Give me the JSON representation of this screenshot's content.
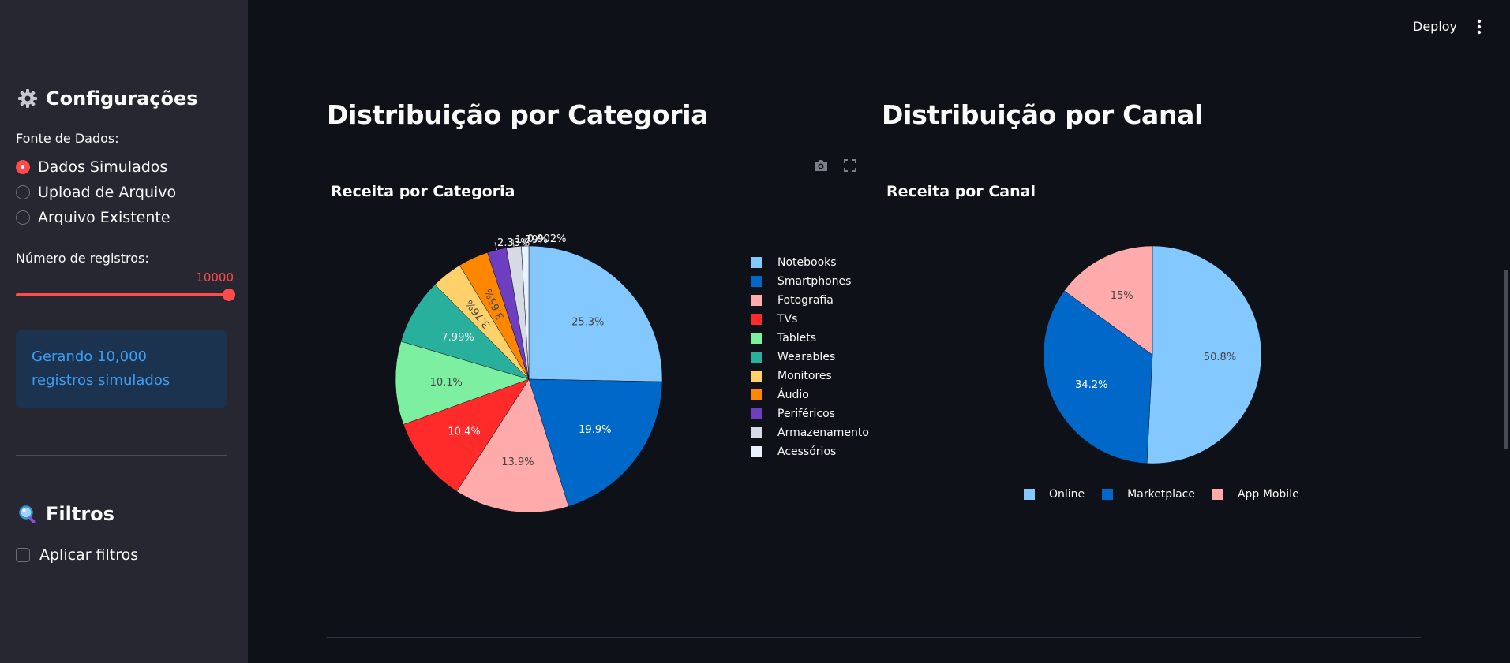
{
  "sidebar": {
    "config_heading": "Configurações",
    "data_source_label": "Fonte de Dados:",
    "radio_options": [
      {
        "label": "Dados Simulados",
        "selected": true
      },
      {
        "label": "Upload de Arquivo",
        "selected": false
      },
      {
        "label": "Arquivo Existente",
        "selected": false
      }
    ],
    "records_label": "Número de registros:",
    "records_value": "10000",
    "records_fraction": 1.0,
    "info_message": "Gerando 10,000 registros simulados",
    "filters_heading": "Filtros",
    "apply_filters_label": "Aplicar filtros",
    "apply_filters_checked": false
  },
  "header": {
    "deploy_label": "Deploy"
  },
  "main": {
    "left_heading": "Distribuição por Categoria",
    "right_heading": "Distribuição por Canal"
  },
  "chart_data": [
    {
      "type": "pie",
      "title": "Receita por Categoria",
      "labels": [
        "Notebooks",
        "Smartphones",
        "Fotografia",
        "TVs",
        "Tablets",
        "Wearables",
        "Monitores",
        "Áudio",
        "Periféricos",
        "Armazenamento",
        "Acessórios"
      ],
      "values": [
        25.3,
        19.9,
        13.9,
        10.4,
        10.1,
        7.99,
        3.76,
        3.65,
        2.33,
        1.79,
        0.902
      ],
      "text_labels": [
        "25.3%",
        "19.9%",
        "13.9%",
        "10.4%",
        "10.1%",
        "7.99%",
        "3.76%",
        "3.65%",
        "2.33%",
        "1.79%",
        "0.902%"
      ],
      "colors": [
        "#83c9ff",
        "#0068c9",
        "#ffabab",
        "#ff2b2b",
        "#7defa1",
        "#29b09d",
        "#ffd16a",
        "#ff8700",
        "#6d3fc0",
        "#d5dae5",
        "#e8f3ff"
      ],
      "legend_position": "right"
    },
    {
      "type": "pie",
      "title": "Receita por Canal",
      "labels": [
        "Online",
        "Marketplace",
        "App Mobile"
      ],
      "values": [
        50.8,
        34.2,
        15
      ],
      "text_labels": [
        "50.8%",
        "34.2%",
        "15%"
      ],
      "colors": [
        "#83c9ff",
        "#0068c9",
        "#ffabab"
      ],
      "legend_position": "bottom"
    }
  ]
}
